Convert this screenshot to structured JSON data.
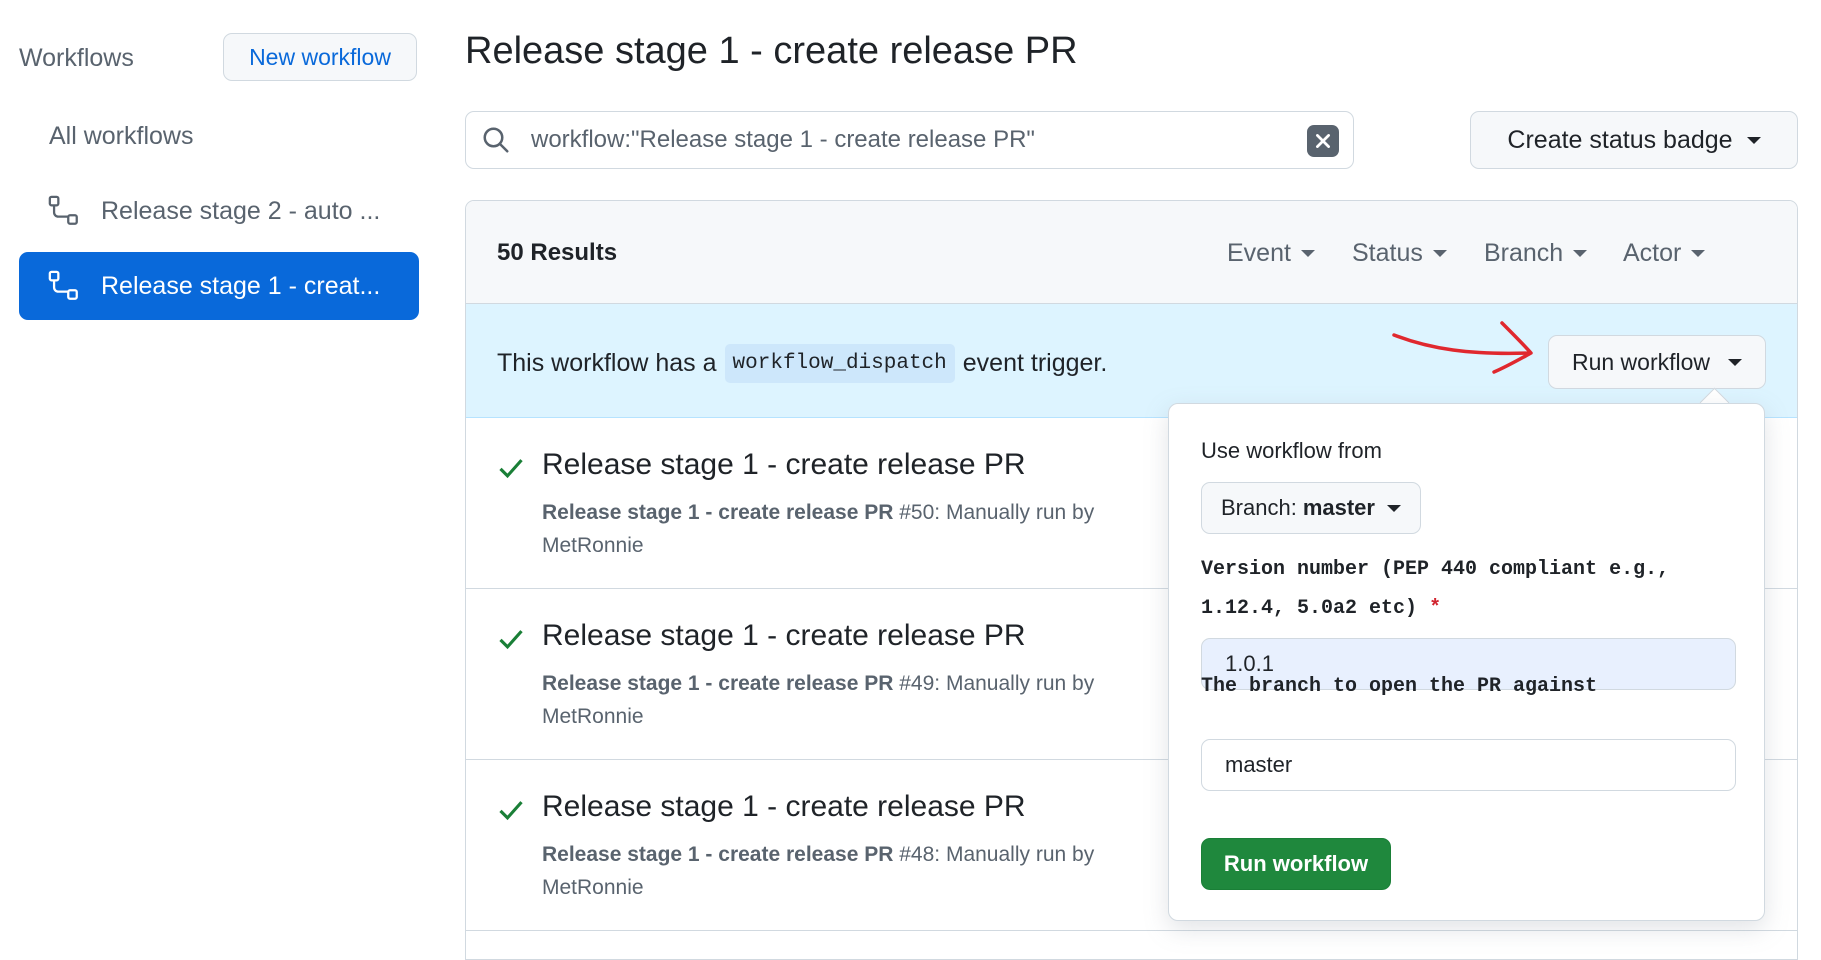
{
  "sidebar": {
    "title": "Workflows",
    "new_workflow": "New workflow",
    "all_workflows": "All workflows",
    "items": [
      {
        "label": "Release stage 2 - auto ..."
      },
      {
        "label": "Release stage 1 - creat..."
      }
    ]
  },
  "main": {
    "title": "Release stage 1 - create release PR",
    "search_query": "workflow:\"Release stage 1 - create release PR\"",
    "status_badge_label": "Create status badge",
    "results": "50 Results",
    "filters": [
      "Event",
      "Status",
      "Branch",
      "Actor"
    ],
    "dispatch": {
      "prefix": "This workflow has a",
      "code": "workflow_dispatch",
      "suffix": "event trigger.",
      "run_label": "Run workflow"
    },
    "runs": [
      {
        "title": "Release stage 1 - create release PR",
        "name": "Release stage 1 - create release PR",
        "meta": " #50: Manually run by",
        "actor": "MetRonnie"
      },
      {
        "title": "Release stage 1 - create release PR",
        "name": "Release stage 1 - create release PR",
        "meta": " #49: Manually run by",
        "actor": "MetRonnie"
      },
      {
        "title": "Release stage 1 - create release PR",
        "name": "Release stage 1 - create release PR",
        "meta": " #48: Manually run by",
        "actor": "MetRonnie"
      }
    ]
  },
  "popover": {
    "use_from_label": "Use workflow from",
    "branch_prefix": "Branch:",
    "branch_value": "master",
    "version_label_line1": "Version number (PEP 440 compliant e.g.,",
    "version_label_line2": "1.12.4, 5.0a2 etc)",
    "required_mark": "*",
    "version_value": "1.0.1",
    "branch_label": "The branch to open the PR against",
    "branch_input_value": "master",
    "submit_label": "Run workflow"
  },
  "colors": {
    "accent": "#0969da",
    "success": "#1f883d",
    "annotation": "#e0282e"
  }
}
